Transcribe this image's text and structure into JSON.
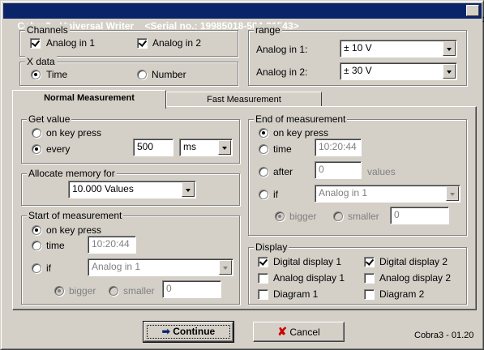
{
  "window": {
    "title": "Cobra3 - Universal Writer    <Serial no.: 19985018-504-91543>",
    "close_glyph": "✕",
    "version": "Cobra3 - 01.20"
  },
  "channels": {
    "title": "Channels",
    "analog1": {
      "label": "Analog in 1",
      "checked": true
    },
    "analog2": {
      "label": "Analog in 2",
      "checked": true
    }
  },
  "xdata": {
    "title": "X data",
    "time": {
      "label": "Time",
      "selected": true
    },
    "number": {
      "label": "Number",
      "selected": false
    }
  },
  "range": {
    "title": "range",
    "analog1_label": "Analog in 1:",
    "analog1_value": "± 10 V",
    "analog2_label": "Analog in 2:",
    "analog2_value": "± 30 V"
  },
  "tabs": [
    {
      "label": "Normal Measurement",
      "active": true
    },
    {
      "label": "Fast Measurement",
      "active": false
    }
  ],
  "get_value": {
    "title": "Get value",
    "on_key_press": "on key press",
    "every": "every",
    "interval": "500",
    "unit": "ms"
  },
  "allocate": {
    "title": "Allocate memory for",
    "value": "10.000 Values"
  },
  "start": {
    "title": "Start of measurement",
    "on_key_press": "on key press",
    "time": "time",
    "time_value": "10:20:44",
    "if": "if",
    "if_value": "Analog in 1",
    "bigger": "bigger",
    "smaller": "smaller",
    "threshold": "0"
  },
  "end": {
    "title": "End of measurement",
    "on_key_press": "on key press",
    "time": "time",
    "time_value": "10:20:44",
    "after": "after",
    "after_value": "0",
    "values_unit": "values",
    "if": "if",
    "if_value": "Analog in 1",
    "bigger": "bigger",
    "smaller": "smaller",
    "threshold": "0"
  },
  "display": {
    "title": "Display",
    "digital1": "Digital display 1",
    "digital2": "Digital display 2",
    "analog1": "Analog display 1",
    "analog2": "Analog display 2",
    "diagram1": "Diagram 1",
    "diagram2": "Diagram 2"
  },
  "buttons": {
    "continue_icon": "➡",
    "continue_label": "Continue",
    "cancel_icon": "✘",
    "cancel_label": "Cancel"
  },
  "colors": {
    "titlebar": "#0a246a",
    "continue_arrow": "#0a246a",
    "cancel_x": "#cc0000"
  }
}
